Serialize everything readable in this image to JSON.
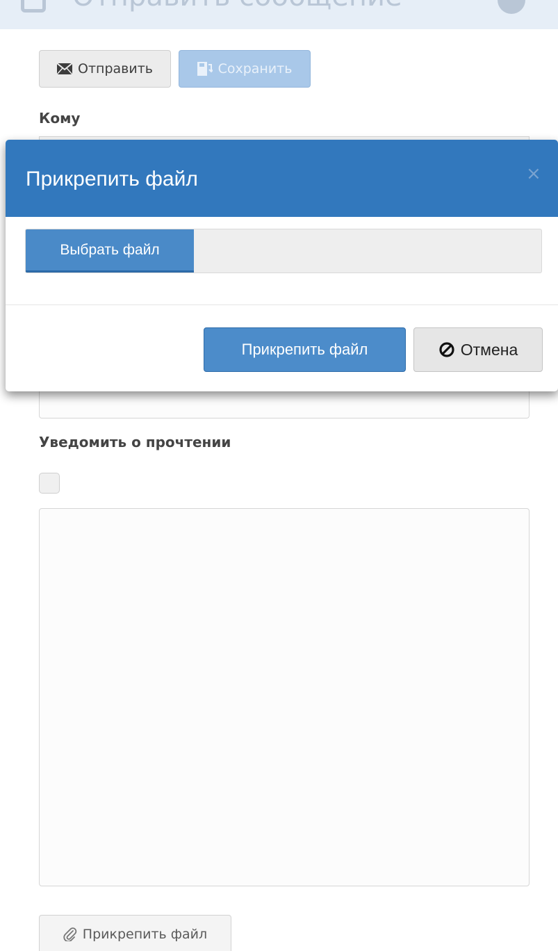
{
  "header": {
    "title": "Отправить сообщение"
  },
  "toolbar": {
    "send_label": "Отправить",
    "save_label": "Сохранить"
  },
  "form": {
    "to_label": "Кому",
    "notify_label": "Уведомить о прочтении",
    "notify_checked": false,
    "message_value": "",
    "attach_button_label": "Прикрепить файл"
  },
  "modal": {
    "title": "Прикрепить файл",
    "close_symbol": "×",
    "choose_file_label": "Выбрать файл",
    "selected_file_name": "",
    "attach_label": "Прикрепить файл",
    "cancel_label": "Отмена"
  },
  "colors": {
    "modal_header": "#3278bd",
    "primary_button": "#4c8cca",
    "save_button_disabled": "#a9c8e9"
  }
}
